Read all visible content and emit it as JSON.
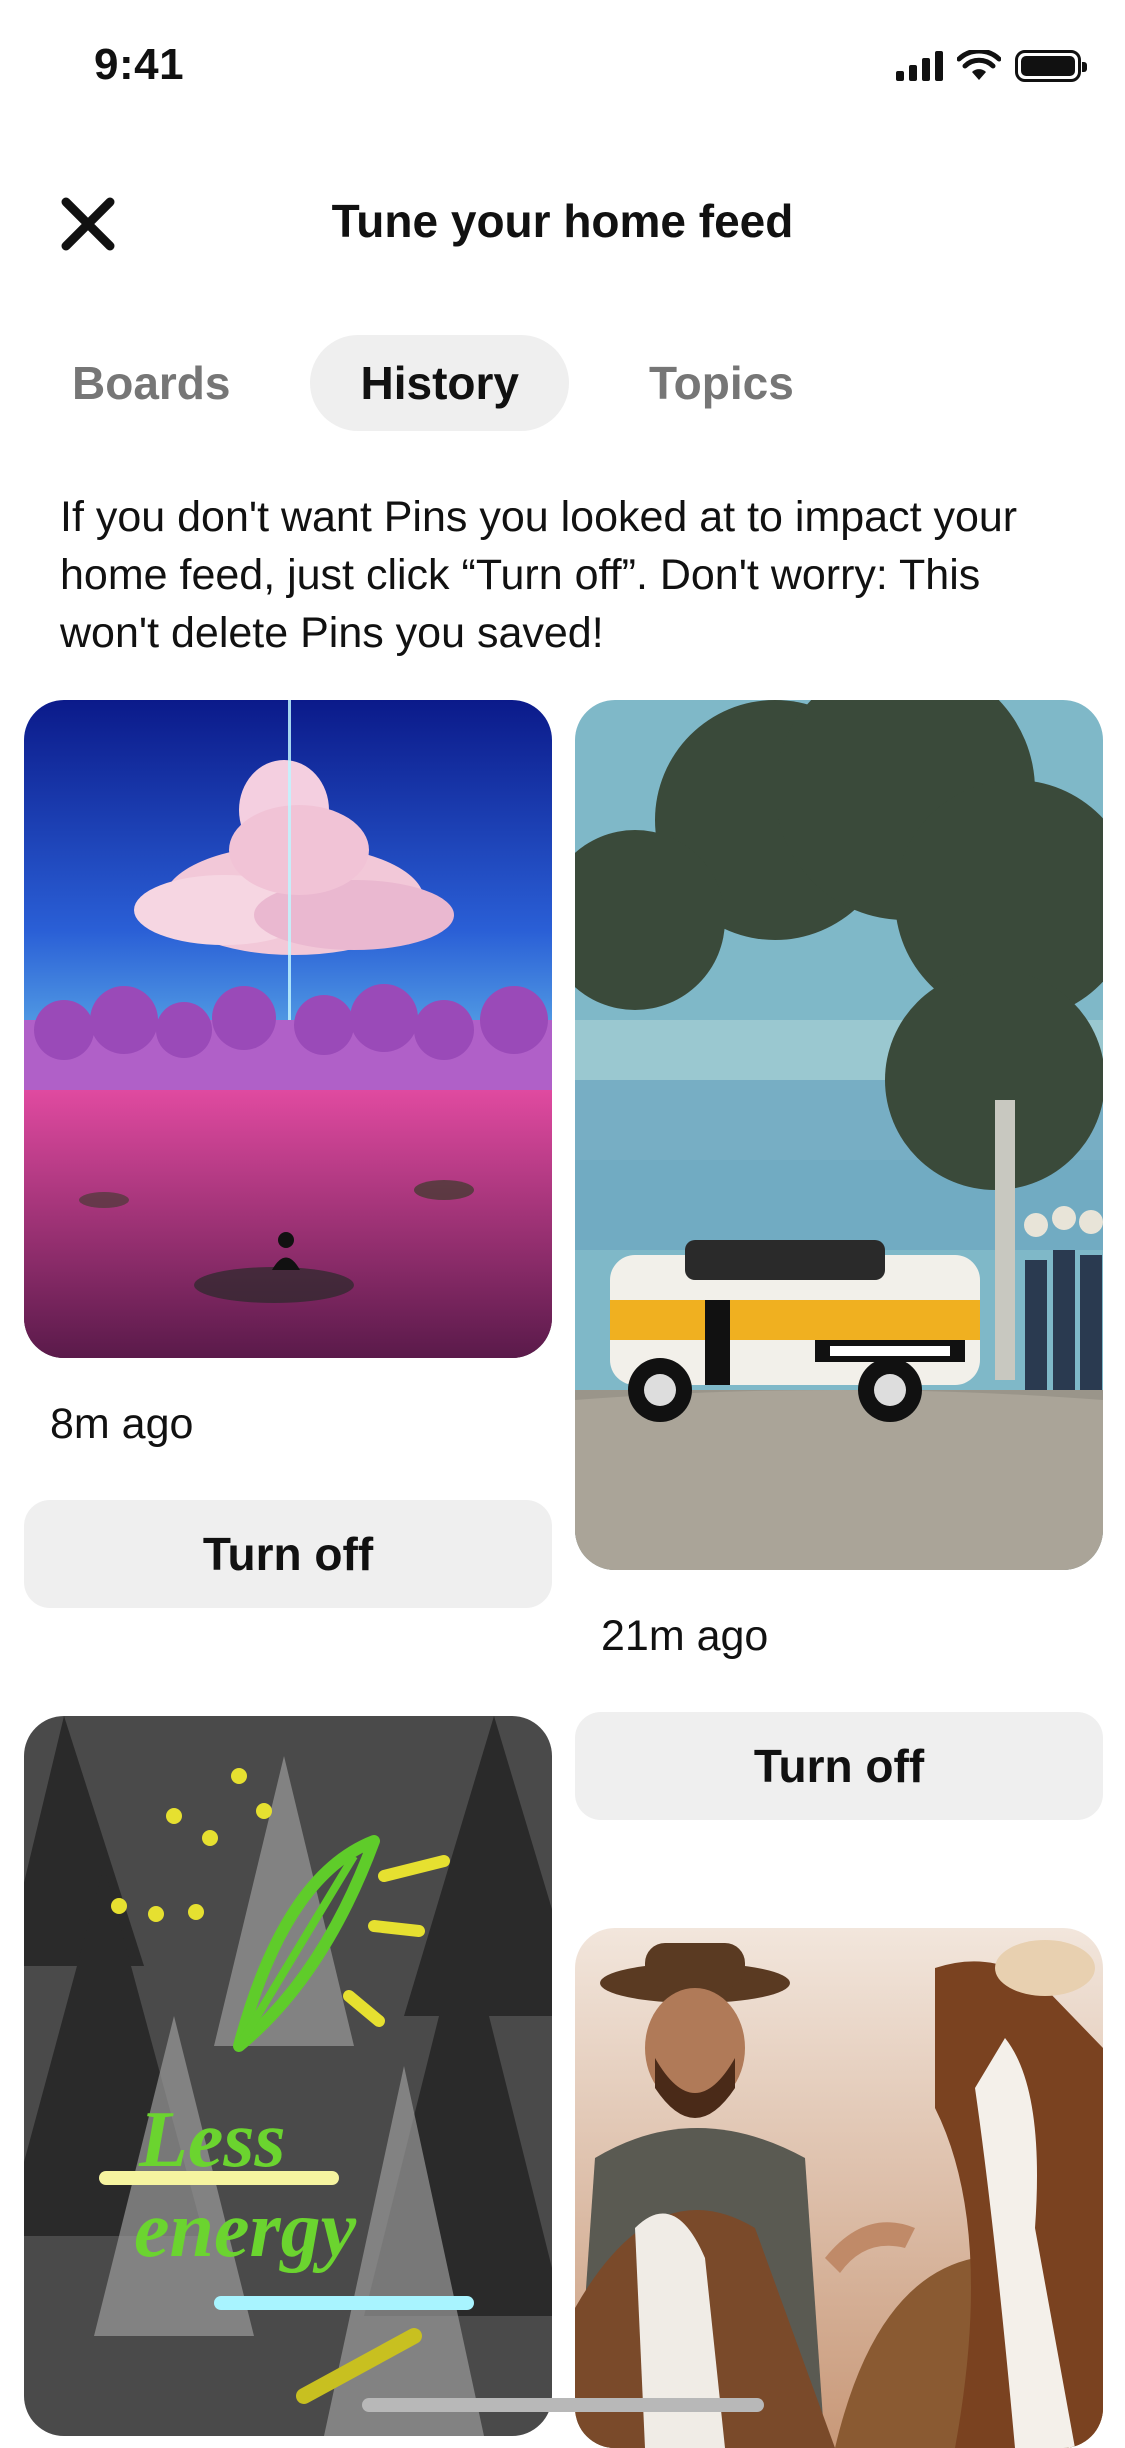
{
  "status_bar": {
    "time": "9:41"
  },
  "header": {
    "title": "Tune your home feed",
    "close_icon": "close-icon"
  },
  "tabs": [
    {
      "label": "Boards",
      "active": false
    },
    {
      "label": "History",
      "active": true
    },
    {
      "label": "Topics",
      "active": false
    }
  ],
  "description": "If you don't want Pins you looked at to impact your home feed, just click “Turn off”. Don't worry: This won't delete Pins you saved!",
  "pins": [
    {
      "time": "8m ago",
      "button_label": "Turn off"
    },
    {
      "time": "21m ago",
      "button_label": "Turn off"
    }
  ],
  "colors": {
    "tab_active_bg": "#efefef",
    "button_bg": "#efefef",
    "muted_text": "#767676"
  }
}
